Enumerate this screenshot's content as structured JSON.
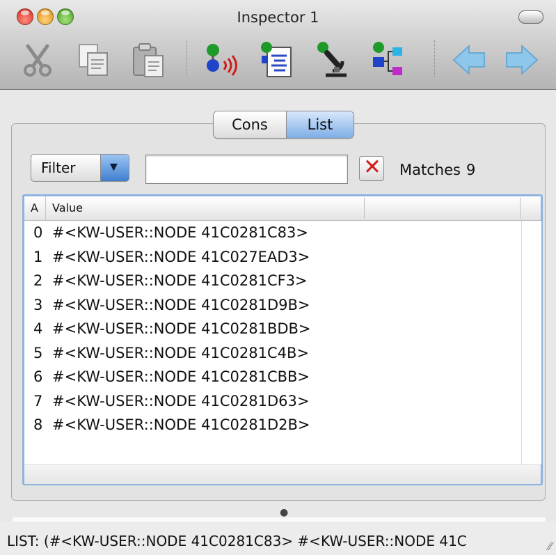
{
  "window": {
    "title": "Inspector 1"
  },
  "toolbar": {
    "icons": [
      "cut-icon",
      "copy-icon",
      "paste-icon",
      "node-signal-icon",
      "node-document-icon",
      "node-microscope-icon",
      "node-hierarchy-icon",
      "back-arrow-icon",
      "forward-arrow-icon"
    ]
  },
  "segmented": {
    "cons": "Cons",
    "list": "List",
    "selected": "List"
  },
  "filter": {
    "label": "Filter",
    "value": "",
    "matches_label": "Matches",
    "matches_count": "9"
  },
  "table": {
    "columns": [
      "A",
      "Value"
    ],
    "rows": [
      {
        "a": "0",
        "value": "#<KW-USER::NODE 41C0281C83>"
      },
      {
        "a": "1",
        "value": "#<KW-USER::NODE 41C027EAD3>"
      },
      {
        "a": "2",
        "value": "#<KW-USER::NODE 41C0281CF3>"
      },
      {
        "a": "3",
        "value": "#<KW-USER::NODE 41C0281D9B>"
      },
      {
        "a": "4",
        "value": "#<KW-USER::NODE 41C0281BDB>"
      },
      {
        "a": "5",
        "value": "#<KW-USER::NODE 41C0281C4B>"
      },
      {
        "a": "6",
        "value": "#<KW-USER::NODE 41C0281CBB>"
      },
      {
        "a": "7",
        "value": "#<KW-USER::NODE 41C0281D63>"
      },
      {
        "a": "8",
        "value": "#<KW-USER::NODE 41C0281D2B>"
      }
    ]
  },
  "status": {
    "text": "LIST: (#<KW-USER::NODE 41C0281C83> #<KW-USER::NODE 41C"
  }
}
